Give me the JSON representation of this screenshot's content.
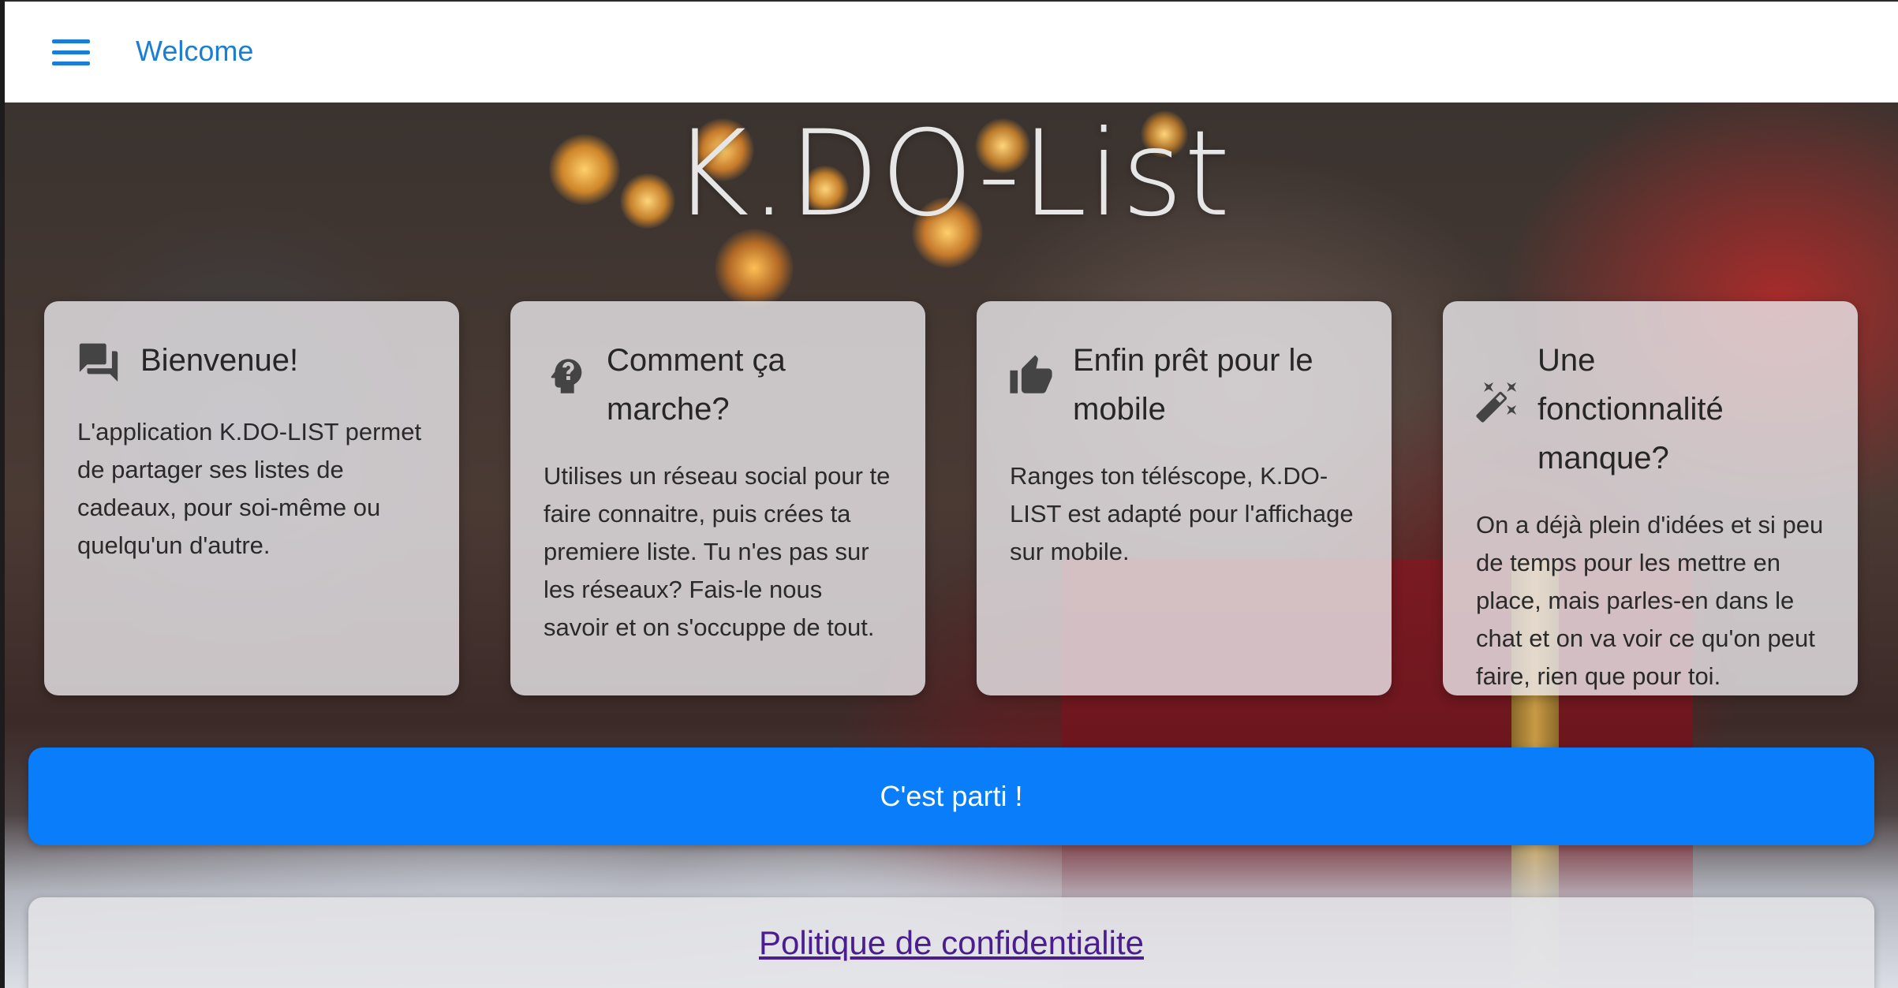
{
  "appbar": {
    "title": "Welcome",
    "menu_icon": "hamburger-menu-icon",
    "accent_color": "#1a7fd4"
  },
  "hero": {
    "title": "K.DO-List"
  },
  "cards": [
    {
      "icon": "chat-bubbles-icon",
      "title": "Bienvenue!",
      "text": "L'application K.DO-LIST permet de partager ses listes de cadeaux, pour soi-même ou quelqu'un d'autre."
    },
    {
      "icon": "help-head-icon",
      "title": "Comment ça marche?",
      "text": "Utilises un réseau social pour te faire connaitre, puis crées ta premiere liste. Tu n'es pas sur les réseaux? Fais-le nous savoir et on s'occuppe de tout."
    },
    {
      "icon": "thumb-up-icon",
      "title": "Enfin prêt pour le mobile",
      "text": "Ranges ton téléscope, K.DO-LIST est adapté pour l'affichage sur mobile."
    },
    {
      "icon": "magic-wand-icon",
      "title": "Une fonctionnalité manque?",
      "text": "On a déjà plein d'idées et si peu de temps pour les mettre en place, mais parles-en dans le chat et on va voir ce qu'on peut faire, rien que pour toi."
    }
  ],
  "cta": {
    "label": "C'est parti !",
    "color": "#0a7dfa"
  },
  "footer": {
    "privacy_link": "Politique de confidentialite",
    "link_color": "#4b1e8f"
  }
}
